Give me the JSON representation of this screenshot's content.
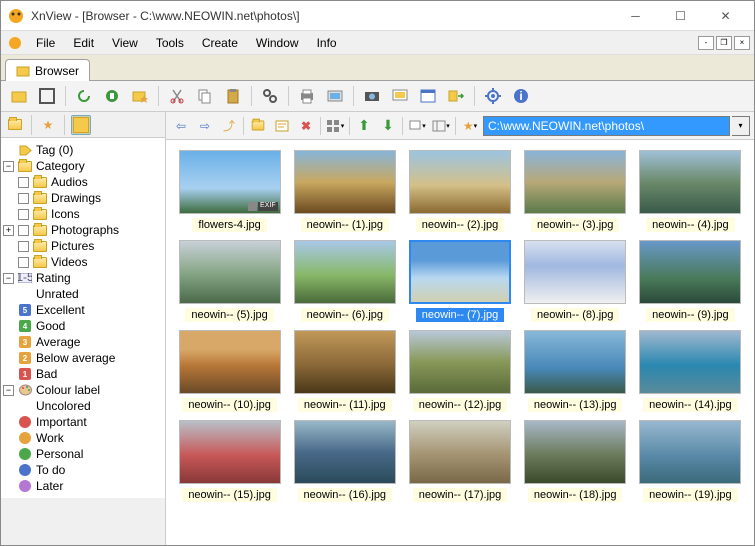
{
  "window": {
    "title": "XnView - [Browser - C:\\www.NEOWIN.net\\photos\\]"
  },
  "menu": {
    "items": [
      "File",
      "Edit",
      "View",
      "Tools",
      "Create",
      "Window",
      "Info"
    ]
  },
  "tab": {
    "label": "Browser"
  },
  "categorytree": {
    "tag": {
      "label": "Tag (0)"
    },
    "category": {
      "label": "Category",
      "children": [
        "Audios",
        "Drawings",
        "Icons",
        "Photographs",
        "Pictures",
        "Videos"
      ]
    },
    "rating": {
      "label": "Rating",
      "items": [
        {
          "label": "Unrated",
          "glyph": "",
          "bg": ""
        },
        {
          "label": "Excellent",
          "glyph": "5",
          "bg": "#4a74c9"
        },
        {
          "label": "Good",
          "glyph": "4",
          "bg": "#4aa84a"
        },
        {
          "label": "Average",
          "glyph": "3",
          "bg": "#e6a23c"
        },
        {
          "label": "Below average",
          "glyph": "2",
          "bg": "#e6a23c"
        },
        {
          "label": "Bad",
          "glyph": "1",
          "bg": "#d9534f"
        }
      ]
    },
    "colour": {
      "label": "Colour label",
      "items": [
        {
          "label": "Uncolored",
          "color": ""
        },
        {
          "label": "Important",
          "color": "#d9534f"
        },
        {
          "label": "Work",
          "color": "#e6a23c"
        },
        {
          "label": "Personal",
          "color": "#4aa84a"
        },
        {
          "label": "To do",
          "color": "#4a74c9"
        },
        {
          "label": "Later",
          "color": "#b477d4"
        }
      ]
    }
  },
  "path": {
    "value": "C:\\www.NEOWIN.net\\photos\\"
  },
  "thumbs": [
    {
      "name": "flowers-4.jpg",
      "cls": "sky1",
      "exif": true,
      "sel": false
    },
    {
      "name": "neowin-- (1).jpg",
      "cls": "sky2",
      "sel": false
    },
    {
      "name": "neowin-- (2).jpg",
      "cls": "sky3",
      "sel": false
    },
    {
      "name": "neowin-- (3).jpg",
      "cls": "sky4",
      "sel": false
    },
    {
      "name": "neowin-- (4).jpg",
      "cls": "sky5",
      "sel": false
    },
    {
      "name": "neowin-- (5).jpg",
      "cls": "sky6",
      "sel": false
    },
    {
      "name": "neowin-- (6).jpg",
      "cls": "sky7",
      "sel": false
    },
    {
      "name": "neowin-- (7).jpg",
      "cls": "sky8",
      "sel": true
    },
    {
      "name": "neowin-- (8).jpg",
      "cls": "sky9",
      "sel": false
    },
    {
      "name": "neowin-- (9).jpg",
      "cls": "sky10",
      "sel": false
    },
    {
      "name": "neowin-- (10).jpg",
      "cls": "sky11",
      "sel": false
    },
    {
      "name": "neowin-- (11).jpg",
      "cls": "sky12",
      "sel": false
    },
    {
      "name": "neowin-- (12).jpg",
      "cls": "sky13",
      "sel": false
    },
    {
      "name": "neowin-- (13).jpg",
      "cls": "sky14",
      "sel": false
    },
    {
      "name": "neowin-- (14).jpg",
      "cls": "sky15",
      "sel": false
    },
    {
      "name": "neowin-- (15).jpg",
      "cls": "sky16",
      "sel": false
    },
    {
      "name": "neowin-- (16).jpg",
      "cls": "sky17",
      "sel": false
    },
    {
      "name": "neowin-- (17).jpg",
      "cls": "sky18",
      "sel": false
    },
    {
      "name": "neowin-- (18).jpg",
      "cls": "sky19",
      "sel": false
    },
    {
      "name": "neowin-- (19).jpg",
      "cls": "sky20",
      "sel": false
    }
  ]
}
